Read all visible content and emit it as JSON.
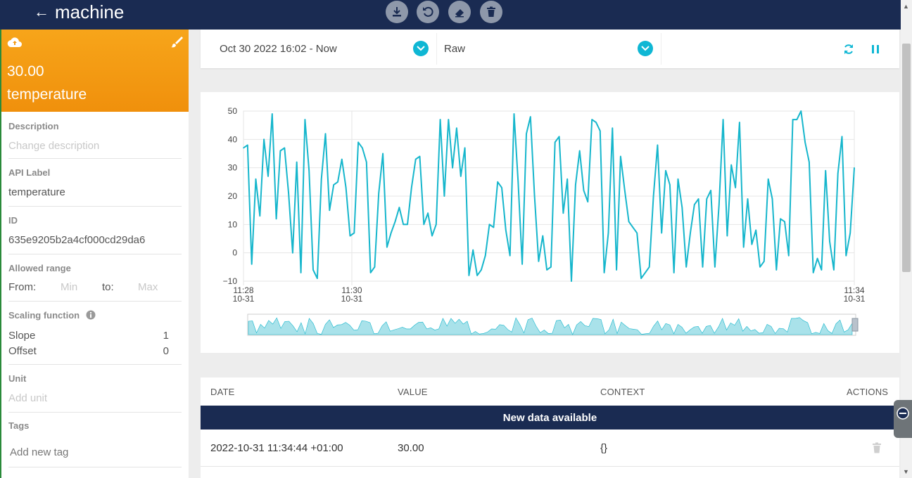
{
  "header": {
    "title": "machine",
    "back_icon": "arrow-left-icon",
    "tools": [
      "download-icon",
      "undo-icon",
      "eraser-icon",
      "trash-icon"
    ]
  },
  "sidebar": {
    "value": "30.00",
    "name": "temperature",
    "description_label": "Description",
    "description_placeholder": "Change description",
    "api_label_label": "API Label",
    "api_label_value": "temperature",
    "id_label": "ID",
    "id_value": "635e9205b2a4cf000cd29da6",
    "allowed_range_label": "Allowed range",
    "from_label": "From:",
    "min_placeholder": "Min",
    "to_label": "to:",
    "max_placeholder": "Max",
    "scaling_label": "Scaling function",
    "slope_label": "Slope",
    "slope_value": "1",
    "offset_label": "Offset",
    "offset_value": "0",
    "unit_label": "Unit",
    "unit_placeholder": "Add unit",
    "tags_label": "Tags",
    "tags_placeholder": "Add new tag"
  },
  "filters": {
    "date_range": "Oct 30 2022 16:02 - Now",
    "aggregation": "Raw"
  },
  "colors": {
    "header": "#1a2b52",
    "accent": "#0fb7d4",
    "card": "#f7a51a"
  },
  "chart_data": {
    "type": "line",
    "y_ticks": [
      "50",
      "40",
      "30",
      "20",
      "10",
      "0",
      "-10"
    ],
    "ylim": [
      -10,
      50
    ],
    "x_ticks": [
      {
        "time": "11:28",
        "date": "10-31"
      },
      {
        "time": "11:30",
        "date": "10-31"
      },
      {
        "time": "11:34",
        "date": "10-31"
      }
    ],
    "grid": true,
    "values": [
      37,
      38,
      -4,
      26,
      13,
      40,
      27,
      49,
      12,
      36,
      37,
      21,
      0,
      32,
      -7,
      47,
      29,
      -6,
      -9,
      26,
      42,
      15,
      24,
      25,
      33,
      23,
      6,
      7,
      39,
      37,
      32,
      -7,
      -5,
      21,
      35,
      2,
      7,
      11,
      16,
      10,
      10,
      23,
      33,
      34,
      10,
      14,
      6,
      10,
      47,
      20,
      47,
      30,
      44,
      27,
      37,
      -8,
      1,
      -8,
      -6,
      -1,
      10,
      9,
      25,
      23,
      8,
      -1,
      49,
      25,
      -4,
      42,
      48,
      20,
      -3,
      6,
      -6,
      -5,
      39,
      41,
      14,
      26,
      -10,
      24,
      36,
      22,
      18,
      47,
      46,
      43,
      -7,
      7,
      44,
      -6,
      34,
      22,
      11,
      9,
      7,
      -9,
      -7,
      -5,
      20,
      38,
      7,
      29,
      24,
      -7,
      26,
      16,
      -5,
      7,
      17,
      19,
      -5,
      19,
      22,
      -5,
      17,
      47,
      6,
      31,
      23,
      46,
      2,
      19,
      3,
      8,
      -5,
      -3,
      26,
      19,
      -6,
      12,
      11,
      -1,
      47,
      47,
      50,
      39,
      32,
      -7,
      -2,
      -6,
      29,
      4,
      -6,
      28,
      41,
      -1,
      7,
      30
    ]
  },
  "table": {
    "headers": [
      "DATE",
      "VALUE",
      "CONTEXT",
      "ACTIONS"
    ],
    "banner": "New data available",
    "rows": [
      {
        "date": "2022-10-31 11:34:44 +01:00",
        "value": "30.00",
        "context": "{}"
      }
    ]
  }
}
